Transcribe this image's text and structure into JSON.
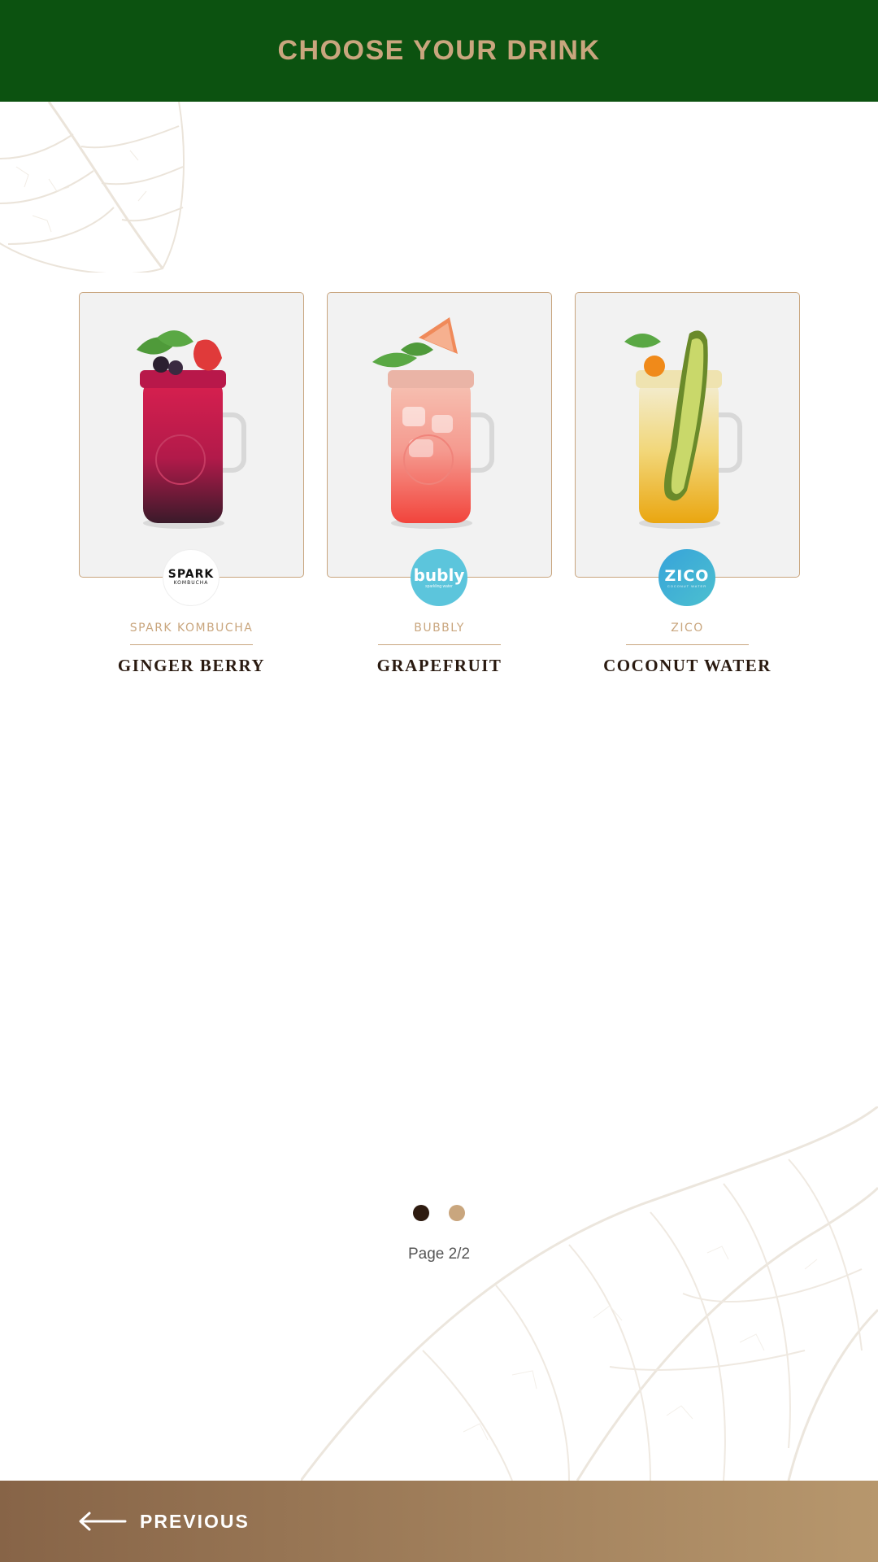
{
  "header": {
    "title": "CHOOSE YOUR DRINK"
  },
  "drinks": [
    {
      "brand": "SPARK KOMBUCHA",
      "name": "GINGER BERRY",
      "logo": {
        "line1": "SPARK",
        "line2": "KOMBUCHA",
        "icon": "spark-kombucha-logo"
      }
    },
    {
      "brand": "BUBBLY",
      "name": "GRAPEFRUIT",
      "logo": {
        "line1": "bubly",
        "line2": "sparkling water",
        "icon": "bubly-logo"
      }
    },
    {
      "brand": "ZICO",
      "name": "COCONUT WATER",
      "logo": {
        "line1": "ZICO",
        "line2": "COCONUT WATER",
        "icon": "zico-logo"
      }
    }
  ],
  "pagination": {
    "label": "Page 2/2",
    "current": 2,
    "total": 2
  },
  "footer": {
    "previous_label": "PREVIOUS"
  },
  "colors": {
    "header_bg": "#0c5210",
    "accent_gold": "#c9a67e",
    "text_dark": "#2a1a10",
    "footer_gradient_start": "#876447",
    "footer_gradient_end": "#b7976d"
  }
}
